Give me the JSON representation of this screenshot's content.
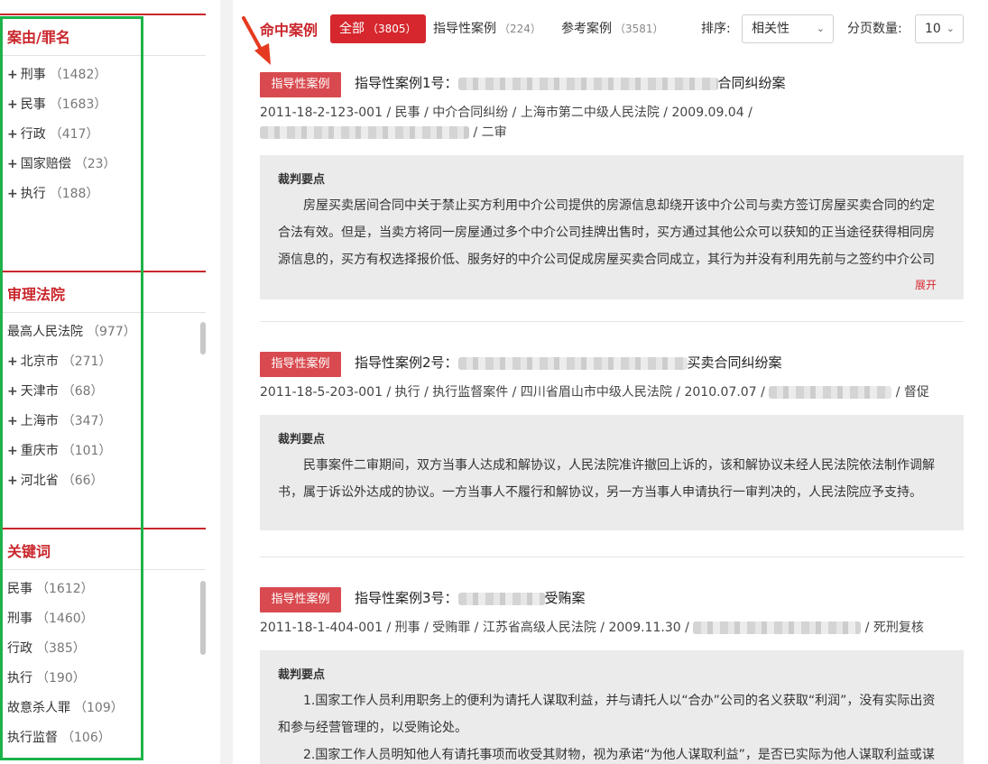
{
  "sidebar": {
    "facets": [
      {
        "title": "案由/罪名",
        "items": [
          {
            "plus": true,
            "label": "刑事",
            "count": "（1482）"
          },
          {
            "plus": true,
            "label": "民事",
            "count": "（1683）"
          },
          {
            "plus": true,
            "label": "行政",
            "count": "（417）"
          },
          {
            "plus": true,
            "label": "国家赔偿",
            "count": "（23）"
          },
          {
            "plus": true,
            "label": "执行",
            "count": "（188）"
          }
        ]
      },
      {
        "title": "审理法院",
        "items": [
          {
            "plus": false,
            "label": "最高人民法院",
            "count": "（977）"
          },
          {
            "plus": true,
            "label": "北京市",
            "count": "（271）"
          },
          {
            "plus": true,
            "label": "天津市",
            "count": "（68）"
          },
          {
            "plus": true,
            "label": "上海市",
            "count": "（347）"
          },
          {
            "plus": true,
            "label": "重庆市",
            "count": "（101）"
          },
          {
            "plus": true,
            "label": "河北省",
            "count": "（66）"
          }
        ]
      },
      {
        "title": "关键词",
        "items": [
          {
            "plus": false,
            "label": "民事",
            "count": "（1612）"
          },
          {
            "plus": false,
            "label": "刑事",
            "count": "（1460）"
          },
          {
            "plus": false,
            "label": "行政",
            "count": "（385）"
          },
          {
            "plus": false,
            "label": "执行",
            "count": "（190）"
          },
          {
            "plus": false,
            "label": "故意杀人罪",
            "count": "（109）"
          },
          {
            "plus": false,
            "label": "执行监督",
            "count": "（106）"
          }
        ]
      }
    ]
  },
  "topbar": {
    "title": "命中案例",
    "tabs": [
      {
        "label": "全部",
        "count": "（3805）",
        "active": true
      },
      {
        "label": "指导性案例",
        "count": "（224）",
        "active": false
      },
      {
        "label": "参考案例",
        "count": "（3581）",
        "active": false
      }
    ],
    "sort_label": "排序:",
    "sort_value": "相关性",
    "page_size_label": "分页数量:",
    "page_size_value": "10"
  },
  "cases": [
    {
      "badge": "指导性案例",
      "title_prefix": "指导性案例1号：",
      "title_suffix": "合同纠纷案",
      "meta_prefix": "2011-18-2-123-001 / 民事 / 中介合同纠纷 / 上海市第二中级人民法院 / 2009.09.04 /",
      "meta_suffix": "/ 二审",
      "summary_label": "裁判要点",
      "paragraphs": [
        "房屋买卖居间合同中关于禁止买方利用中介公司提供的房源信息却绕开该中介公司与卖方签订房屋买卖合同的约定合法有效。但是，当卖方将同一房屋通过多个中介公司挂牌出售时，买方通过其他公众可以获知的正当途径获得相同房源信息的，买方有权选择报价低、服务好的中介公司促成房屋买卖合同成立，其行为并没有利用先前与之签约中介公司"
      ],
      "expand": "展开"
    },
    {
      "badge": "指导性案例",
      "title_prefix": "指导性案例2号：",
      "title_suffix": "买卖合同纠纷案",
      "meta_prefix": "2011-18-5-203-001 / 执行 / 执行监督案件 / 四川省眉山市中级人民法院 / 2010.07.07 /",
      "meta_suffix": "/ 督促",
      "summary_label": "裁判要点",
      "paragraphs": [
        "民事案件二审期间，双方当事人达成和解协议，人民法院准许撤回上诉的，该和解协议未经人民法院依法制作调解书，属于诉讼外达成的协议。一方当事人不履行和解协议，另一方当事人申请执行一审判决的，人民法院应予支持。"
      ]
    },
    {
      "badge": "指导性案例",
      "title_prefix": "指导性案例3号：",
      "title_suffix": "受贿案",
      "meta_prefix": "2011-18-1-404-001 / 刑事 / 受贿罪 / 江苏省高级人民法院 / 2009.11.30 /",
      "meta_suffix": "/ 死刑复核",
      "summary_label": "裁判要点",
      "paragraphs": [
        "1.国家工作人员利用职务上的便利为请托人谋取利益，并与请托人以“合办”公司的名义获取“利润”，没有实际出资和参与经营管理的，以受贿论处。",
        "2.国家工作人员明知他人有请托事项而收受其财物，视为承诺“为他人谋取利益”，是否已实际为他人谋取利益或谋"
      ]
    }
  ],
  "colors": {
    "accent": "#d6272e",
    "badge": "#d84a4f",
    "highlight_frame": "#1db34a",
    "summary_bg": "#ebebeb"
  }
}
